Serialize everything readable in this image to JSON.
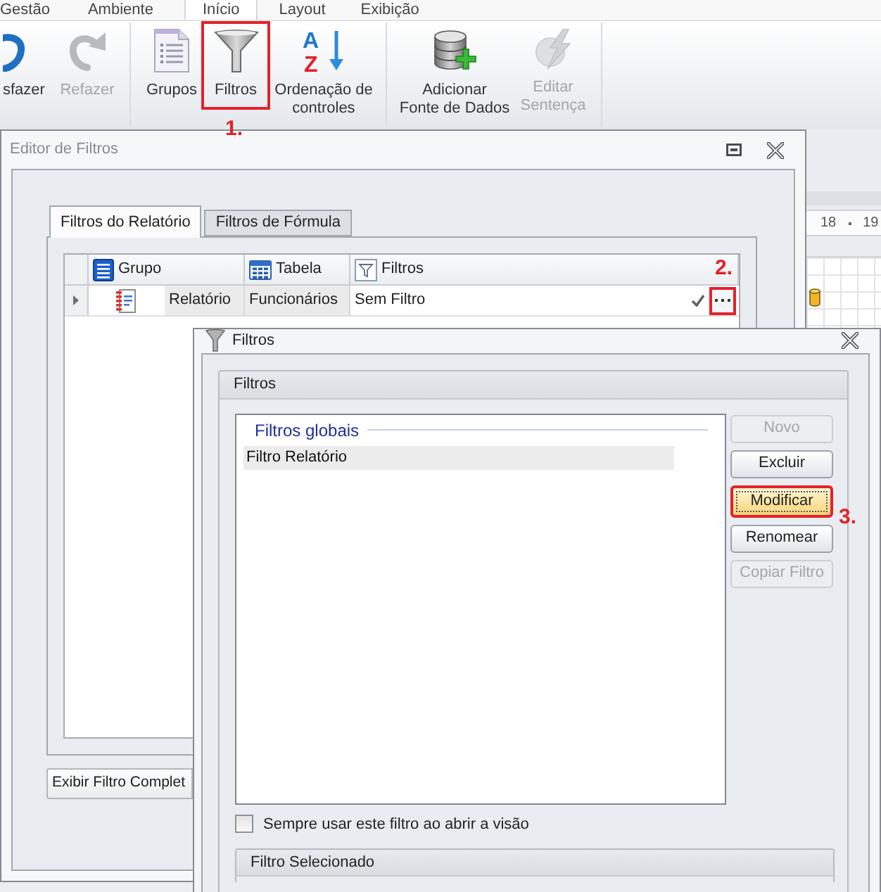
{
  "ribbon": {
    "tabs": [
      {
        "label": "Gestão",
        "selected": false
      },
      {
        "label": "Ambiente",
        "selected": false
      },
      {
        "label": "Início",
        "selected": true
      },
      {
        "label": "Layout",
        "selected": false
      },
      {
        "label": "Exibição",
        "selected": false
      }
    ],
    "groups": [
      {
        "buttons": [
          {
            "kind": "undo",
            "lines": [
              "sfazer"
            ],
            "disabled": false
          },
          {
            "kind": "redo",
            "lines": [
              "Refazer"
            ],
            "disabled": true
          }
        ]
      },
      {
        "buttons": [
          {
            "kind": "groups",
            "lines": [
              "Grupos"
            ],
            "disabled": false
          },
          {
            "kind": "filter",
            "lines": [
              "Filtros"
            ],
            "disabled": false,
            "callout": "1."
          },
          {
            "kind": "sort",
            "lines": [
              "Ordenação de",
              "controles"
            ],
            "disabled": false,
            "icon_letters": [
              "A",
              "Z"
            ]
          }
        ]
      },
      {
        "buttons": [
          {
            "kind": "add_datasource",
            "lines": [
              "Adicionar",
              "Fonte de Dados"
            ],
            "disabled": false
          },
          {
            "kind": "edit_sentence",
            "lines": [
              "Editar",
              "Sentença"
            ],
            "disabled": true
          }
        ]
      }
    ]
  },
  "background": {
    "ruler": [
      "18",
      "19"
    ]
  },
  "filter_editor": {
    "title": "Editor de Filtros",
    "tabs": [
      {
        "label": "Filtros do Relatório",
        "selected": true
      },
      {
        "label": "Filtros de Fórmula",
        "selected": false
      }
    ],
    "grid": {
      "columns": [
        {
          "kind": "group",
          "label": "Grupo"
        },
        {
          "kind": "table",
          "label": "Tabela"
        },
        {
          "kind": "filter",
          "label": "Filtros"
        }
      ],
      "rows": [
        {
          "current": true,
          "cells": [
            {
              "kind": "group",
              "text": "Relatório"
            },
            {
              "kind": "text",
              "text": "Funcionários"
            },
            {
              "kind": "editor",
              "text": "Sem Filtro",
              "callout": "2."
            }
          ]
        }
      ]
    },
    "footer_button": "Exibir Filtro Complet"
  },
  "filters_dialog": {
    "title": "Filtros",
    "group_title": "Filtros",
    "list": {
      "section": "Filtros globais",
      "items": [
        {
          "label": "Filtro Relatório",
          "selected": true
        }
      ]
    },
    "buttons": [
      {
        "label": "Novo",
        "disabled": true,
        "focused": false
      },
      {
        "label": "Excluir",
        "disabled": false,
        "focused": false
      },
      {
        "label": "Modificar",
        "disabled": false,
        "focused": true,
        "callout": "3."
      },
      {
        "label": "Renomear",
        "disabled": false,
        "focused": false
      },
      {
        "label": "Copiar Filtro",
        "disabled": true,
        "focused": false
      }
    ],
    "checkbox": {
      "label": "Sempre usar este filtro ao abrir a visão",
      "checked": false
    },
    "selected_group_title": "Filtro Selecionado"
  }
}
